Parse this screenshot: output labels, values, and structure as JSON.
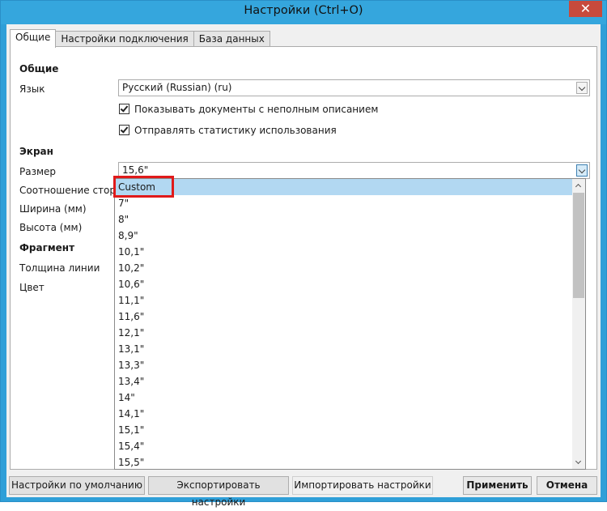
{
  "window": {
    "title": "Настройки (Ctrl+O)",
    "close_label": "✕"
  },
  "tabs": [
    {
      "label": "Общие",
      "active": true
    },
    {
      "label": "Настройки подключения",
      "active": false
    },
    {
      "label": "База данных",
      "active": false
    }
  ],
  "general": {
    "section_title": "Общие",
    "language_label": "Язык",
    "language_value": "Русский (Russian) (ru)",
    "checkbox_incomplete_docs": "Показывать документы с неполным описанием",
    "checkbox_incomplete_docs_checked": true,
    "checkbox_usage_stats": "Отправлять статистику использования",
    "checkbox_usage_stats_checked": true
  },
  "screen": {
    "section_title": "Экран",
    "size_label": "Размер",
    "size_value": "15,6\"",
    "aspect_label": "Соотношение сторон",
    "width_label": "Ширина (мм)",
    "height_label": "Высота (мм)"
  },
  "fragment": {
    "section_title": "Фрагмент",
    "line_thickness_label": "Толщина линии",
    "color_label": "Цвет"
  },
  "size_dropdown": {
    "selected": "Custom",
    "options": [
      "Custom",
      "7\"",
      "8\"",
      "8,9\"",
      "10,1\"",
      "10,2\"",
      "10,6\"",
      "11,1\"",
      "11,6\"",
      "12,1\"",
      "13,1\"",
      "13,3\"",
      "13,4\"",
      "14\"",
      "14,1\"",
      "15,1\"",
      "15,4\"",
      "15,5\""
    ]
  },
  "buttons": {
    "defaults": "Настройки по умолчанию",
    "export": "Экспортировать настройки",
    "import": "Импортировать настройки",
    "apply": "Применить",
    "cancel": "Отмена"
  },
  "colors": {
    "titlebar": "#35a6dd",
    "selection": "#b2d8f2",
    "highlight_box": "#e01a1a"
  }
}
